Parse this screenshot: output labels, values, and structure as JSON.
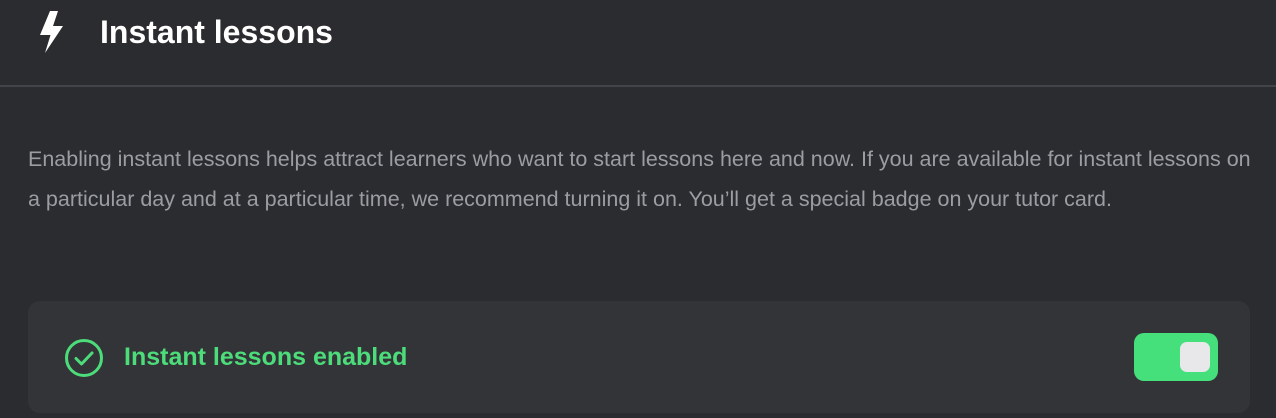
{
  "header": {
    "icon": "lightning-bolt-icon",
    "title": "Instant lessons"
  },
  "description": "Enabling instant lessons helps attract learners who want to start lessons here and now. If you are available for instant lessons on a particular day and at a particular time, we recommend turning it on. You’ll get a special badge on your tutor card.",
  "status_card": {
    "icon": "check-circle-icon",
    "label": "Instant lessons enabled",
    "toggle_state": "on"
  },
  "colors": {
    "background": "#2b2c30",
    "card_background": "#333438",
    "accent_green": "#45e07c",
    "text_muted": "#9c9ca3",
    "text_primary": "#ffffff"
  }
}
